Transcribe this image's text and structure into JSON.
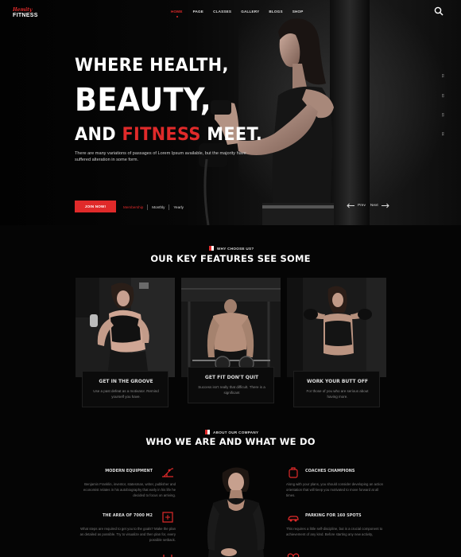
{
  "brand": {
    "script": "Hemity",
    "name": "FITNESS"
  },
  "nav": {
    "items": [
      "HOME",
      "PAGE",
      "CLASSES",
      "GALLERY",
      "BLOGS",
      "SHOP"
    ],
    "active": "HOME"
  },
  "hero": {
    "line1": "WHERE HEALTH,",
    "line2": "BEAUTY,",
    "line3_prefix": "AND",
    "line3_red": "FITNESS",
    "line3_suffix": "MEET.",
    "description": "There are many variations of passages of Lorem Ipsum available, but the majority have suffered alteration in some form.",
    "join_label": "JOIN NOW!",
    "tabs": [
      "Membership",
      "Monthly",
      "Yearly"
    ],
    "prev_label": "Prev",
    "next_label": "Next",
    "slide_numbers": [
      "01",
      "02",
      "03",
      "04"
    ]
  },
  "features": {
    "tag": "WHY CHOOSE US?",
    "title": "OUR KEY FEATURES SEE SOME",
    "cards": [
      {
        "title": "GET IN THE GROOVE",
        "text": "Use a past defeat as a motivator. Remind yourself you have."
      },
      {
        "title": "GET FIT DON'T QUIT",
        "text": "Success isn't really that difficult. There is a significant"
      },
      {
        "title": "WORK YOUR BUTT OFF",
        "text": "For those of you who are serious about having more."
      }
    ]
  },
  "about": {
    "tag": "ABOUT OUR COMPANY",
    "title": "WHO WE ARE AND WHAT WE DO",
    "left": [
      {
        "title": "MODERN EQUIPMENT",
        "text": "Benjamin Franklin, inventor, statesman, writer, publisher and economist relates in his autobiography that early in his life he decided to focus on arriving.",
        "icon": "treadmill-icon"
      },
      {
        "title": "THE AREA OF 7000 M2",
        "text": "What steps are required to get you to the goals? Make the plan as detailed as possible. Try to visualize and then plan for, every possible setback.",
        "icon": "area-icon"
      }
    ],
    "right": [
      {
        "title": "COACHES CHAMPIONS",
        "text": "Along with your plans, you should consider developing an action orientation that will keep you motivated to move forward at all times.",
        "icon": "coach-icon"
      },
      {
        "title": "PARKING FOR 160 SPOTS",
        "text": "This requires a little self-discipline, but is a crucial component to achievement of any kind. Before starting any new activity,",
        "icon": "parking-icon"
      }
    ]
  },
  "colors": {
    "accent": "#e02a2a",
    "background": "#050505",
    "text": "#ffffff"
  }
}
